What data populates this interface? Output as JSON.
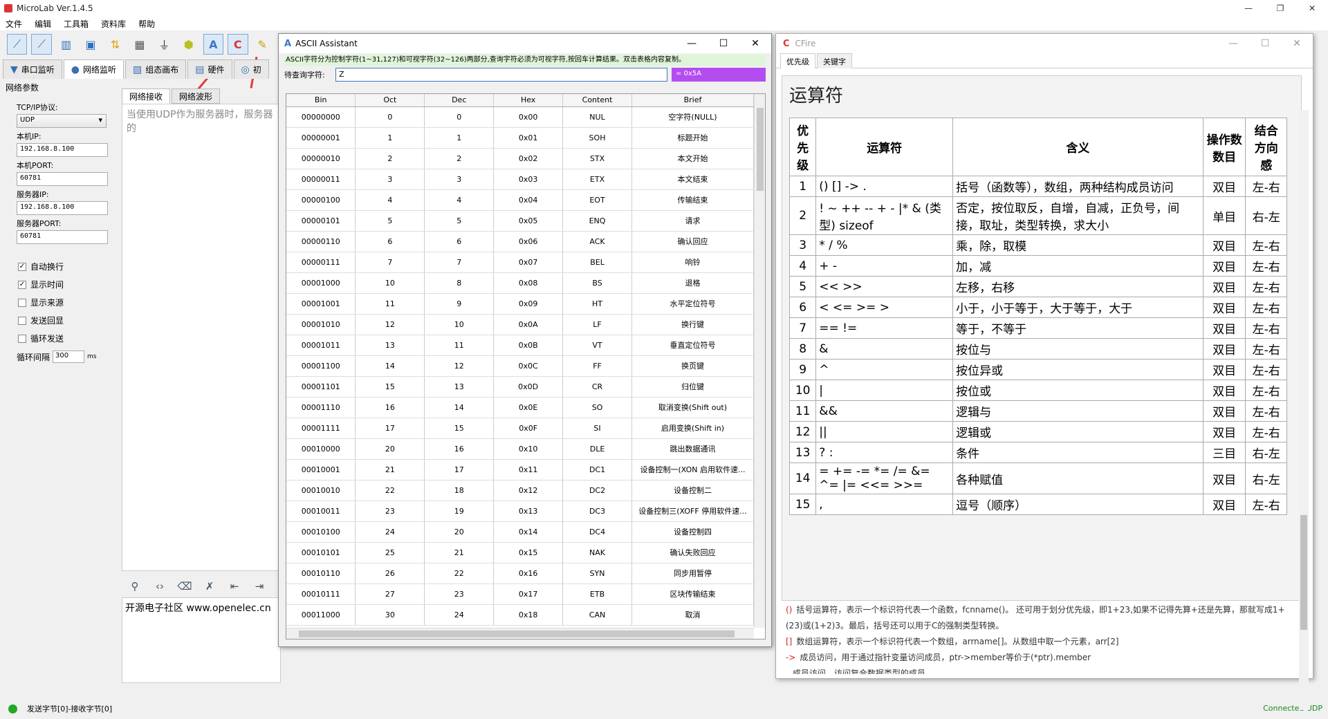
{
  "main_window": {
    "title": "MicroLab Ver.1.4.5",
    "controls": [
      "—",
      "❐",
      "✕"
    ],
    "menu": [
      "文件",
      "编辑",
      "工具箱",
      "资料库",
      "帮助"
    ],
    "toolbar_icons": [
      "connect-icon",
      "disconnect-icon",
      "layout-icon",
      "window-icon",
      "sort-icon",
      "calculator-icon",
      "circuit-icon",
      "package-icon",
      "ascii-icon",
      "cfire-icon",
      "tool-icon"
    ],
    "mode_tabs": [
      {
        "label": "串口监听",
        "icon": "serial-icon"
      },
      {
        "label": "网络监听",
        "icon": "globe-icon"
      },
      {
        "label": "组态画布",
        "icon": "canvas-icon"
      },
      {
        "label": "硬件",
        "icon": "hardware-icon"
      }
    ],
    "mode_tab_extra": "初"
  },
  "left_panel": {
    "heading": "网络参数",
    "protocol_label": "TCP/IP协议:",
    "protocol_value": "UDP",
    "local_ip_label": "本机IP:",
    "local_ip_value": "192.168.8.100",
    "local_port_label": "本机PORT:",
    "local_port_value": "60781",
    "server_ip_label": "服务器IP:",
    "server_ip_value": "192.168.8.100",
    "server_port_label": "服务器PORT:",
    "server_port_value": "60781",
    "checkboxes": [
      {
        "label": "自动换行",
        "checked": true
      },
      {
        "label": "显示时间",
        "checked": true
      },
      {
        "label": "显示来源",
        "checked": false
      },
      {
        "label": "发送回显",
        "checked": false
      },
      {
        "label": "循环发送",
        "checked": false
      }
    ],
    "interval_label": "循环间隔",
    "interval_value": "300",
    "interval_unit": "ms"
  },
  "net_area": {
    "tabs": [
      "网络接收",
      "网络波形"
    ],
    "recv_hint": "当使用UDP作为服务器时，服务器的",
    "send_text": "开源电子社区 www.openelec.cn"
  },
  "statusbar": {
    "left": "发送字节[0]-接收字节[0]",
    "right": "Connected UDP"
  },
  "ascii": {
    "title": "ASCII Assistant",
    "controls": [
      "—",
      "☐",
      "✕"
    ],
    "description": "ASCII字符分为控制字符(1~31,127)和可视字符(32~126)两部分,查询字符必须为可视字符,按回车计算结果。双击表格内容复制。",
    "query_label": "待查询字符:",
    "query_value": "Z",
    "result": "= 0x5A",
    "columns": [
      "Bin",
      "Oct",
      "Dec",
      "Hex",
      "Content",
      "Brief"
    ],
    "rows": [
      [
        "00000000",
        "0",
        "0",
        "0x00",
        "NUL",
        "空字符(NULL)"
      ],
      [
        "00000001",
        "1",
        "1",
        "0x01",
        "SOH",
        "标题开始"
      ],
      [
        "00000010",
        "2",
        "2",
        "0x02",
        "STX",
        "本文开始"
      ],
      [
        "00000011",
        "3",
        "3",
        "0x03",
        "ETX",
        "本文结束"
      ],
      [
        "00000100",
        "4",
        "4",
        "0x04",
        "EOT",
        "传输结束"
      ],
      [
        "00000101",
        "5",
        "5",
        "0x05",
        "ENQ",
        "请求"
      ],
      [
        "00000110",
        "6",
        "6",
        "0x06",
        "ACK",
        "确认回应"
      ],
      [
        "00000111",
        "7",
        "7",
        "0x07",
        "BEL",
        "响铃"
      ],
      [
        "00001000",
        "10",
        "8",
        "0x08",
        "BS",
        "退格"
      ],
      [
        "00001001",
        "11",
        "9",
        "0x09",
        "HT",
        "水平定位符号"
      ],
      [
        "00001010",
        "12",
        "10",
        "0x0A",
        "LF",
        "换行键"
      ],
      [
        "00001011",
        "13",
        "11",
        "0x0B",
        "VT",
        "垂直定位符号"
      ],
      [
        "00001100",
        "14",
        "12",
        "0x0C",
        "FF",
        "换页键"
      ],
      [
        "00001101",
        "15",
        "13",
        "0x0D",
        "CR",
        "归位键"
      ],
      [
        "00001110",
        "16",
        "14",
        "0x0E",
        "SO",
        "取消变换(Shift out)"
      ],
      [
        "00001111",
        "17",
        "15",
        "0x0F",
        "SI",
        "启用变换(Shift in)"
      ],
      [
        "00010000",
        "20",
        "16",
        "0x10",
        "DLE",
        "跳出数据通讯"
      ],
      [
        "00010001",
        "21",
        "17",
        "0x11",
        "DC1",
        "设备控制一(XON 启用软件速..."
      ],
      [
        "00010010",
        "22",
        "18",
        "0x12",
        "DC2",
        "设备控制二"
      ],
      [
        "00010011",
        "23",
        "19",
        "0x13",
        "DC3",
        "设备控制三(XOFF 停用软件速..."
      ],
      [
        "00010100",
        "24",
        "20",
        "0x14",
        "DC4",
        "设备控制四"
      ],
      [
        "00010101",
        "25",
        "21",
        "0x15",
        "NAK",
        "确认失败回应"
      ],
      [
        "00010110",
        "26",
        "22",
        "0x16",
        "SYN",
        "同步用暂停"
      ],
      [
        "00010111",
        "27",
        "23",
        "0x17",
        "ETB",
        "区块传输结束"
      ],
      [
        "00011000",
        "30",
        "24",
        "0x18",
        "CAN",
        "取消"
      ]
    ]
  },
  "cfire": {
    "title": "CFire",
    "controls": [
      "—",
      "☐",
      "✕"
    ],
    "tabs": [
      "优先级",
      "关键字"
    ],
    "heading": "运算符",
    "columns": [
      "优先级",
      "运算符",
      "含义",
      "操作数数目",
      "结合方向感"
    ],
    "rows": [
      [
        "1",
        "() [] -> .",
        "括号（函数等），数组，两种结构成员访问",
        "双目",
        "左-右"
      ],
      [
        "2",
        "! ~ ++ -- + - |* & (类型) sizeof",
        "否定，按位取反，自增，自减，正负号，间接，取址，类型转换，求大小",
        "单目",
        "右-左"
      ],
      [
        "3",
        "* / %",
        "乘，除，取模",
        "双目",
        "左-右"
      ],
      [
        "4",
        "+ -",
        "加，减",
        "双目",
        "左-右"
      ],
      [
        "5",
        "<< >>",
        "左移，右移",
        "双目",
        "左-右"
      ],
      [
        "6",
        "< <= >= >",
        "小于，小于等于，大于等于，大于",
        "双目",
        "左-右"
      ],
      [
        "7",
        "== !=",
        "等于，不等于",
        "双目",
        "左-右"
      ],
      [
        "8",
        "&",
        "按位与",
        "双目",
        "左-右"
      ],
      [
        "9",
        "^",
        "按位异或",
        "双目",
        "左-右"
      ],
      [
        "10",
        "|",
        "按位或",
        "双目",
        "左-右"
      ],
      [
        "11",
        "&&",
        "逻辑与",
        "双目",
        "左-右"
      ],
      [
        "12",
        "||",
        "逻辑或",
        "双目",
        "左-右"
      ],
      [
        "13",
        "? :",
        "条件",
        "三目",
        "右-左"
      ],
      [
        "14",
        "= += -= *= /= &= ^= |= <<= >>=",
        "各种赋值",
        "双目",
        "右-左"
      ],
      [
        "15",
        ",",
        "逗号（顺序）",
        "双目",
        "左-右"
      ]
    ],
    "notes": [
      {
        "sym": "()",
        "text": "括号运算符，表示一个标识符代表一个函数，fcnname()。 还可用于划分优先级，即1+23,如果不记得先算+还是先算，那就写成1+(23)或(1+2)3。最后，括号还可以用于C的强制类型转换。"
      },
      {
        "sym": "[]",
        "text": "数组运算符，表示一个标识符代表一个数组，arrname[]。从数组中取一个元素，arr[2]"
      },
      {
        "sym": "->",
        "text": "成员访问，用于通过指针变量访问成员，ptr->member等价于(*ptr).member"
      },
      {
        "sym": ".",
        "text": "成员访问，访问复合数据类型的成员"
      }
    ]
  }
}
